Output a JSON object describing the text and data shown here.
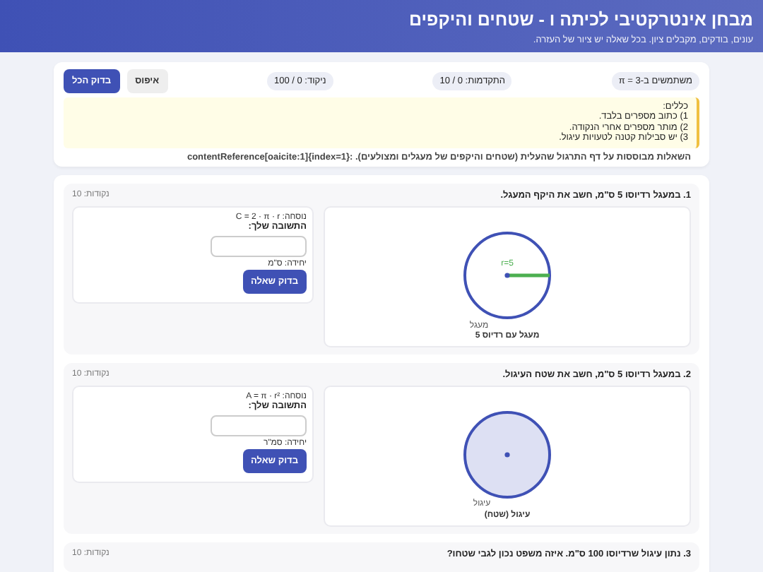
{
  "header": {
    "title": "מבחן אינטרקטיבי לכיתה ו - שטחים והיקפים",
    "subtitle": "עונים, בודקים, מקבלים ציון. בכל שאלה יש ציור של העזרה."
  },
  "controls": {
    "pi_note": "משתמשים ב-π = 3",
    "progress": "התקדמות: 0 / 10",
    "score": "ניקוד: 0 / 100",
    "buttons": [
      {
        "kind": "reset",
        "label": "איפוס"
      },
      {
        "kind": "primary",
        "label": "בדוק הכל"
      }
    ]
  },
  "rules": [
    "כללים:",
    "1) כתוב מספרים בלבד.",
    "2) מותר מספרים אחרי הנקודה.",
    "3) יש סבילות קטנה לטעויות עיגול."
  ],
  "source_note": "השאלות מבוססות על דף התרגול שהעלית (שטחים והיקפים של מעגלים ומצולעים). :contentReference[oaicite:1]{index=1}",
  "questions": [
    {
      "title": "1. במעגל רדיוסו 5 ס\"מ, חשב את היקף המעגל.",
      "points": "נקודות: 10",
      "figure": {
        "kind": "circumference",
        "radius_label": "r=5",
        "shape_label": "מעגל",
        "caption": "מעגל עם רדיוס 5"
      },
      "formula": "נוסחה: C = 2 · π · r",
      "answer_label": "התשובה שלך:",
      "unit": "יחידה: ס\"מ",
      "button": "בדוק שאלה"
    },
    {
      "title": "2. במעגל רדיוסו 5 ס\"מ, חשב את שטח העיגול.",
      "points": "נקודות: 10",
      "figure": {
        "kind": "area",
        "shape_label": "עיגול",
        "caption": "עיגול (שטח)"
      },
      "formula": "נוסחה: A = π · r²",
      "answer_label": "התשובה שלך:",
      "unit": "יחידה: סמ\"ר",
      "button": "בדוק שאלה"
    },
    {
      "title": "3. נתון עיגול שרדיוסו 100 ס\"מ. איזה משפט נכון לגבי שטחו?",
      "points": "נקודות: 10"
    }
  ]
}
